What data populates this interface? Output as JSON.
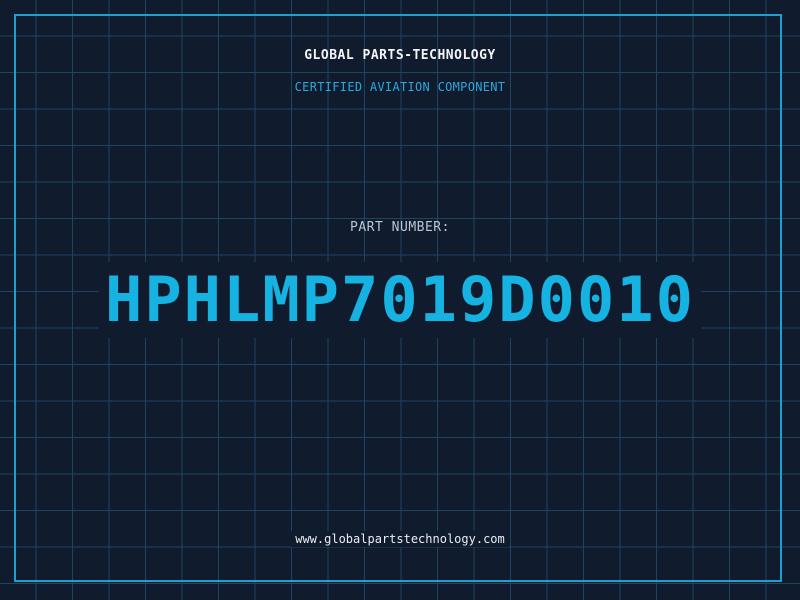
{
  "header": {
    "brand": "GLOBAL PARTS-TECHNOLOGY",
    "subtitle": "CERTIFIED AVIATION COMPONENT"
  },
  "part": {
    "label": "PART NUMBER:",
    "number": "HPHLMP7019D0010"
  },
  "footer": {
    "url": "www.globalpartstechnology.com"
  },
  "colors": {
    "background": "#111b2e",
    "grid": "#1b4660",
    "frame": "#1e9fcf",
    "accent": "#16b2e2"
  }
}
